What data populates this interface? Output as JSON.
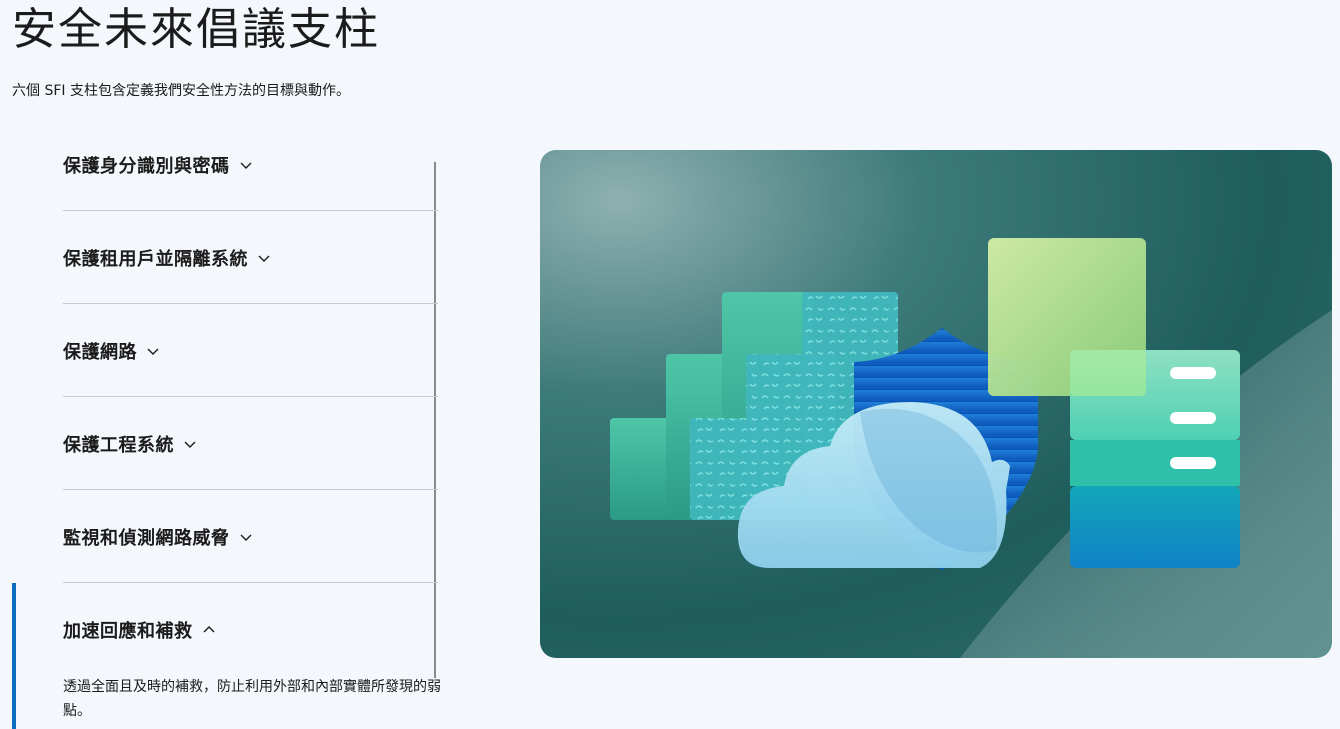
{
  "header": {
    "title": "安全未來倡議支柱",
    "subtitle": "六個 SFI 支柱包含定義我們安全性方法的目標與動作。"
  },
  "accordion": {
    "items": [
      {
        "label": "保護身分識別與密碼",
        "expanded": false
      },
      {
        "label": "保護租用戶並隔離系統",
        "expanded": false
      },
      {
        "label": "保護網路",
        "expanded": false
      },
      {
        "label": "保護工程系統",
        "expanded": false
      },
      {
        "label": "監視和偵測網路威脅",
        "expanded": false
      },
      {
        "label": "加速回應和補救",
        "expanded": true,
        "description": "透過全面且及時的補救，防止利用外部和內部實體所發現的弱點。"
      }
    ]
  },
  "colors": {
    "accent": "#0f6cbd",
    "hero_bg": "#2f6e6e"
  },
  "icons": {
    "collapsed": "chevron-down-icon",
    "expanded": "chevron-up-icon"
  }
}
